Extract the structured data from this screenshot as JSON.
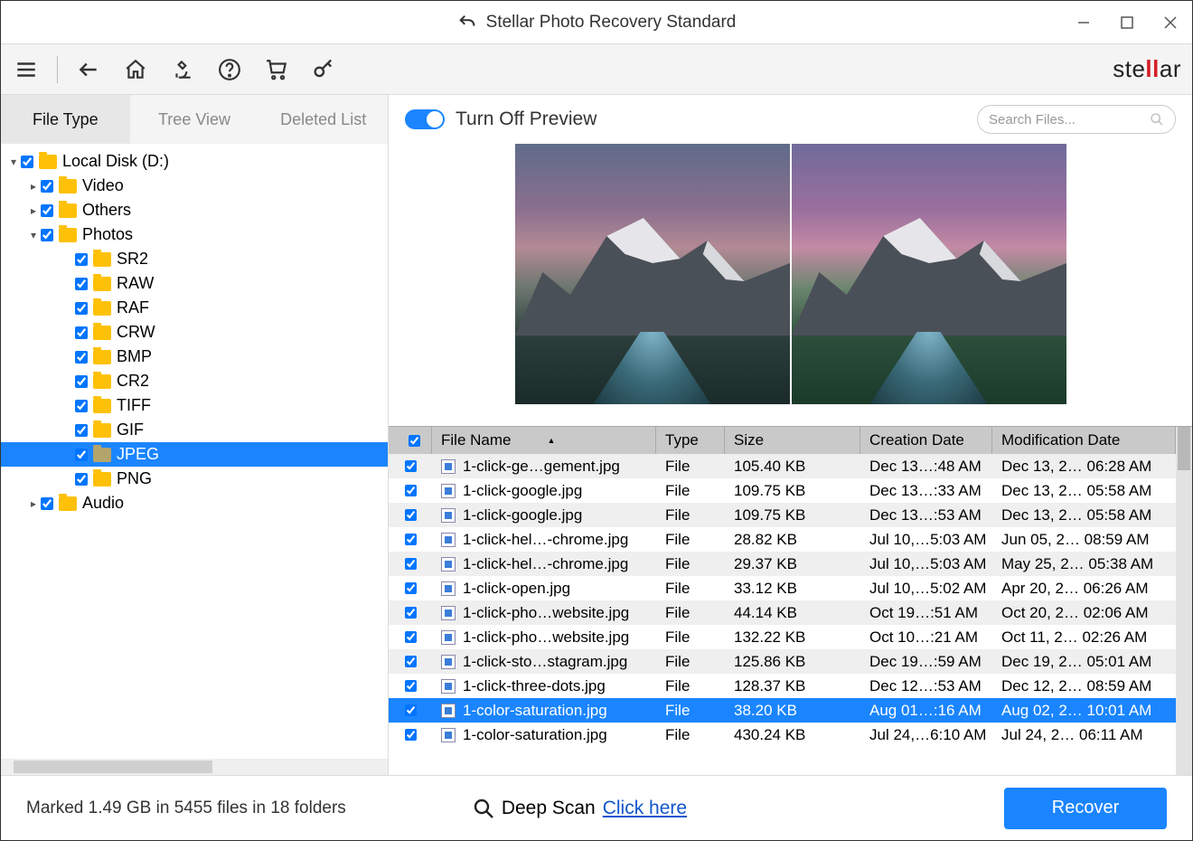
{
  "title": "Stellar Photo Recovery Standard",
  "brand": {
    "pre": "ste",
    "mid": "ll",
    "post": "ar"
  },
  "tabs": {
    "filetype": "File Type",
    "treeview": "Tree View",
    "deleted": "Deleted List"
  },
  "tree": {
    "root": "Local Disk (D:)",
    "video": "Video",
    "others": "Others",
    "photos": "Photos",
    "sr2": "SR2",
    "raw": "RAW",
    "raf": "RAF",
    "crw": "CRW",
    "bmp": "BMP",
    "cr2": "CR2",
    "tiff": "TIFF",
    "gif": "GIF",
    "jpeg": "JPEG",
    "png": "PNG",
    "audio": "Audio"
  },
  "preview": {
    "toggle_label": "Turn Off Preview",
    "search_placeholder": "Search Files..."
  },
  "columns": {
    "name": "File Name",
    "type": "Type",
    "size": "Size",
    "cdate": "Creation Date",
    "mdate": "Modification Date"
  },
  "rows": [
    {
      "name": "1-click-ge…gement.jpg",
      "type": "File",
      "size": "105.40 KB",
      "cdate": "Dec 13…:48 AM",
      "mdate": "Dec 13, 2… 06:28 AM"
    },
    {
      "name": "1-click-google.jpg",
      "type": "File",
      "size": "109.75 KB",
      "cdate": "Dec 13…:33 AM",
      "mdate": "Dec 13, 2… 05:58 AM"
    },
    {
      "name": "1-click-google.jpg",
      "type": "File",
      "size": "109.75 KB",
      "cdate": "Dec 13…:53 AM",
      "mdate": "Dec 13, 2… 05:58 AM"
    },
    {
      "name": "1-click-hel…-chrome.jpg",
      "type": "File",
      "size": "28.82 KB",
      "cdate": "Jul 10,…5:03 AM",
      "mdate": "Jun 05, 2… 08:59 AM"
    },
    {
      "name": "1-click-hel…-chrome.jpg",
      "type": "File",
      "size": "29.37 KB",
      "cdate": "Jul 10,…5:03 AM",
      "mdate": "May 25, 2… 05:38 AM"
    },
    {
      "name": "1-click-open.jpg",
      "type": "File",
      "size": "33.12 KB",
      "cdate": "Jul 10,…5:02 AM",
      "mdate": "Apr 20, 2… 06:26 AM"
    },
    {
      "name": "1-click-pho…website.jpg",
      "type": "File",
      "size": "44.14 KB",
      "cdate": "Oct 19…:51 AM",
      "mdate": "Oct 20, 2… 02:06 AM"
    },
    {
      "name": "1-click-pho…website.jpg",
      "type": "File",
      "size": "132.22 KB",
      "cdate": "Oct 10…:21 AM",
      "mdate": "Oct 11, 2… 02:26 AM"
    },
    {
      "name": "1-click-sto…stagram.jpg",
      "type": "File",
      "size": "125.86 KB",
      "cdate": "Dec 19…:59 AM",
      "mdate": "Dec 19, 2… 05:01 AM"
    },
    {
      "name": "1-click-three-dots.jpg",
      "type": "File",
      "size": "128.37 KB",
      "cdate": "Dec 12…:53 AM",
      "mdate": "Dec 12, 2… 08:59 AM"
    },
    {
      "name": "1-color-saturation.jpg",
      "type": "File",
      "size": "38.20 KB",
      "cdate": "Aug 01…:16 AM",
      "mdate": "Aug 02, 2… 10:01 AM"
    },
    {
      "name": "1-color-saturation.jpg",
      "type": "File",
      "size": "430.24 KB",
      "cdate": "Jul 24,…6:10 AM",
      "mdate": "Jul 24, 2… 06:11 AM"
    }
  ],
  "selected_row_index": 10,
  "footer": {
    "status": "Marked 1.49 GB in 5455 files in 18 folders",
    "deep_label": "Deep Scan",
    "deep_link": "Click here",
    "recover": "Recover"
  }
}
